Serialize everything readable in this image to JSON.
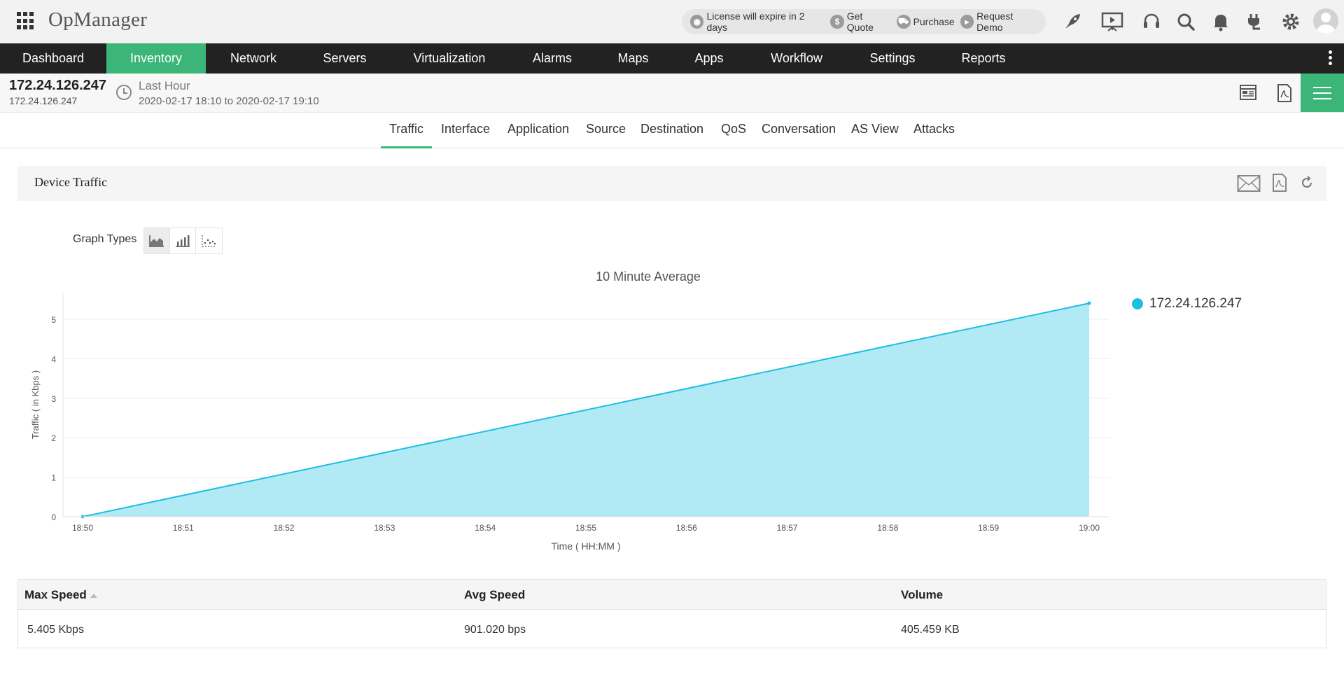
{
  "app": {
    "brand": "OpManager"
  },
  "promo": {
    "license": "License will expire in 2 days",
    "quote": "Get Quote",
    "purchase": "Purchase",
    "demo": "Request Demo"
  },
  "top_icons": [
    "rocket-icon",
    "presentation-icon",
    "headset-icon",
    "search-icon",
    "bell-icon",
    "plug-icon",
    "gear-icon",
    "user-avatar"
  ],
  "nav": {
    "items": [
      {
        "label": "Dashboard",
        "active": false
      },
      {
        "label": "Inventory",
        "active": true
      },
      {
        "label": "Network",
        "active": false
      },
      {
        "label": "Servers",
        "active": false
      },
      {
        "label": "Virtualization",
        "active": false
      },
      {
        "label": "Alarms",
        "active": false
      },
      {
        "label": "Maps",
        "active": false
      },
      {
        "label": "Apps",
        "active": false
      },
      {
        "label": "Workflow",
        "active": false
      },
      {
        "label": "Settings",
        "active": false
      },
      {
        "label": "Reports",
        "active": false
      }
    ]
  },
  "device": {
    "ip": "172.24.126.247",
    "ip_sub": "172.24.126.247",
    "period": "Last Hour",
    "range": "2020-02-17 18:10 to 2020-02-17 19:10"
  },
  "tabs": [
    {
      "label": "Traffic",
      "active": true
    },
    {
      "label": "Interface",
      "active": false
    },
    {
      "label": "Application",
      "active": false
    },
    {
      "label": "Source",
      "active": false
    },
    {
      "label": "Destination",
      "active": false
    },
    {
      "label": "QoS",
      "active": false
    },
    {
      "label": "Conversation",
      "active": false
    },
    {
      "label": "AS View",
      "active": false
    },
    {
      "label": "Attacks",
      "active": false
    }
  ],
  "panel": {
    "title": "Device Traffic",
    "graph_types_label": "Graph Types",
    "selected_graph_type": "area"
  },
  "colors": {
    "accent": "#3bb678",
    "nav_bg": "#222222",
    "series": "#1dbfe0",
    "series_fill": "#b1eaf4"
  },
  "chart_data": {
    "type": "area",
    "title": "10 Minute Average",
    "xlabel": "Time ( HH:MM )",
    "ylabel": "Traffic ( in Kbps )",
    "categories": [
      "18:50",
      "18:51",
      "18:52",
      "18:53",
      "18:54",
      "18:55",
      "18:56",
      "18:57",
      "18:58",
      "18:59",
      "19:00"
    ],
    "yticks": [
      0,
      1,
      2,
      3,
      4,
      5
    ],
    "ylim": [
      0,
      5.5
    ],
    "grid": true,
    "legend_position": "right",
    "series": [
      {
        "name": "172.24.126.247",
        "x": [
          "18:50",
          "19:00"
        ],
        "values": [
          0,
          5.405
        ]
      }
    ]
  },
  "table": {
    "headers": [
      "Max Speed",
      "Avg Speed",
      "Volume"
    ],
    "rows": [
      [
        "5.405 Kbps",
        "901.020 bps",
        "405.459 KB"
      ]
    ]
  }
}
